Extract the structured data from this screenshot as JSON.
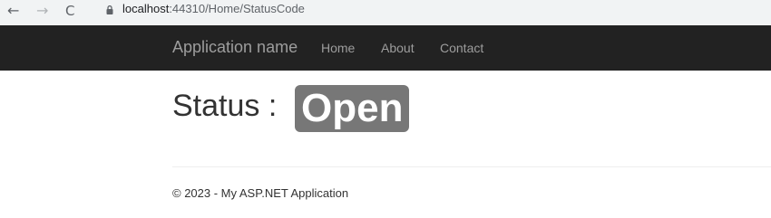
{
  "browser": {
    "back_icon": "←",
    "forward_icon": "→",
    "reload_icon": "C",
    "lock_icon": "lock-icon",
    "address_host": "localhost",
    "address_path": ":44310/Home/StatusCode"
  },
  "navbar": {
    "brand": "Application name",
    "links": [
      "Home",
      "About",
      "Contact"
    ]
  },
  "main": {
    "status_label": "Status :",
    "status_value": "Open"
  },
  "footer": {
    "text": "© 2023 - My ASP.NET Application"
  },
  "colors": {
    "navbar_bg": "#222222",
    "nav_text": "#9d9d9d",
    "badge_bg": "#777777"
  }
}
